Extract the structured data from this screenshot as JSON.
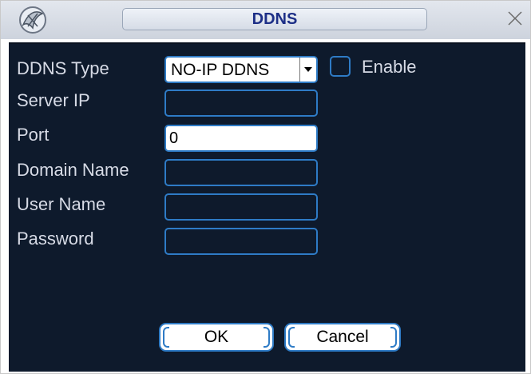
{
  "window": {
    "title": "DDNS",
    "logo_icon": "app-logo-icon",
    "close_icon": "close-icon"
  },
  "form": {
    "ddns_type_label": "DDNS Type",
    "ddns_type_value": "NO-IP DDNS",
    "enable_label": "Enable",
    "enable_checked": false,
    "server_ip_label": "Server IP",
    "server_ip_value": "",
    "port_label": "Port",
    "port_value": "0",
    "domain_name_label": "Domain Name",
    "domain_name_value": "",
    "user_name_label": "User Name",
    "user_name_value": "",
    "password_label": "Password",
    "password_value": ""
  },
  "buttons": {
    "ok_label": "OK",
    "cancel_label": "Cancel"
  },
  "colors": {
    "accent": "#2e7bc6",
    "panel": "#0e1a2c",
    "title_text": "#1d2f87",
    "label_text": "#d7dbe6"
  }
}
